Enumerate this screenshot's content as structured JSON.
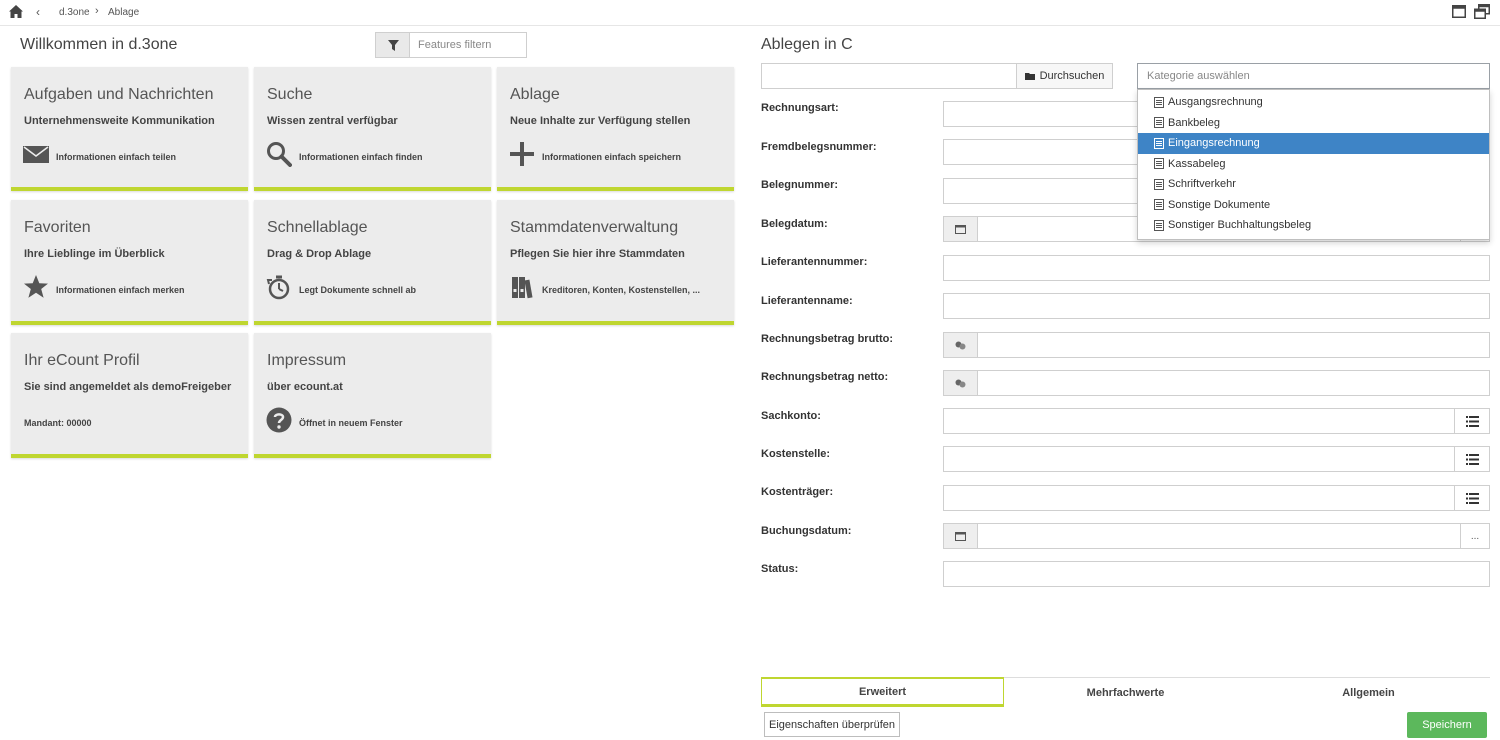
{
  "breadcrumb": {
    "back": "‹",
    "items": [
      "d.3one",
      "Ablage"
    ],
    "separator": "›"
  },
  "left": {
    "title": "Willkommen in d.3one",
    "filter": {
      "placeholder": "Features filtern"
    },
    "tiles": [
      {
        "title": "Aufgaben und Nachrichten",
        "subtitle": "Unternehmensweite Kommunikation",
        "description": "Informationen einfach teilen",
        "icon": "envelope-icon"
      },
      {
        "title": "Suche",
        "subtitle": "Wissen zentral verfügbar",
        "description": "Informationen einfach finden",
        "icon": "search-icon"
      },
      {
        "title": "Ablage",
        "subtitle": "Neue Inhalte zur Verfügung stellen",
        "description": "Informationen einfach speichern",
        "icon": "plus-icon"
      },
      {
        "title": "Favoriten",
        "subtitle": "Ihre Lieblinge im Überblick",
        "description": "Informationen einfach merken",
        "icon": "star-icon"
      },
      {
        "title": "Schnellablage",
        "subtitle": "Drag & Drop Ablage",
        "description": "Legt Dokumente schnell ab",
        "icon": "stopwatch-icon"
      },
      {
        "title": "Stammdatenverwaltung",
        "subtitle": "Pflegen Sie hier ihre Stammdaten",
        "description": "Kreditoren, Konten, Kostenstellen, ...",
        "icon": "binders-icon"
      },
      {
        "title": "Ihr eCount Profil",
        "subtitle": "Sie sind angemeldet als demoFreigeber",
        "description": "Mandant: 00000",
        "icon": ""
      },
      {
        "title": "Impressum",
        "subtitle": "über ecount.at",
        "description": "Öffnet in neuem Fenster",
        "icon": "question-icon"
      }
    ]
  },
  "right": {
    "title": "Ablegen in C",
    "browse_label": "Durchsuchen",
    "category": {
      "placeholder": "Kategorie auswählen",
      "options": [
        "Ausgangsrechnung",
        "Bankbeleg",
        "Eingangsrechnung",
        "Kassabeleg",
        "Schriftverkehr",
        "Sonstige Dokumente",
        "Sonstiger Buchhaltungsbeleg"
      ],
      "selected": "Eingangsrechnung"
    },
    "fields": [
      {
        "label": "Rechnungsart:",
        "type": "text"
      },
      {
        "label": "Fremdbelegsnummer:",
        "type": "text"
      },
      {
        "label": "Belegnummer:",
        "type": "text"
      },
      {
        "label": "Belegdatum:",
        "type": "date"
      },
      {
        "label": "Lieferantennummer:",
        "type": "text"
      },
      {
        "label": "Lieferantenname:",
        "type": "text"
      },
      {
        "label": "Rechnungsbetrag brutto:",
        "type": "money"
      },
      {
        "label": "Rechnungsbetrag netto:",
        "type": "money"
      },
      {
        "label": "Sachkonto:",
        "type": "list"
      },
      {
        "label": "Kostenstelle:",
        "type": "list"
      },
      {
        "label": "Kostenträger:",
        "type": "list"
      },
      {
        "label": "Buchungsdatum:",
        "type": "date"
      },
      {
        "label": "Status:",
        "type": "text"
      }
    ],
    "date_more": "...",
    "tabs": [
      "Erweitert",
      "Mehrfachwerte",
      "Allgemein"
    ],
    "active_tab": "Erweitert",
    "check_button": "Eigenschaften überprüfen",
    "save_button": "Speichern"
  },
  "colors": {
    "accent": "#bfd630",
    "selected": "#3e84c6",
    "save": "#5cb85c",
    "tile_bg": "#ececec"
  }
}
